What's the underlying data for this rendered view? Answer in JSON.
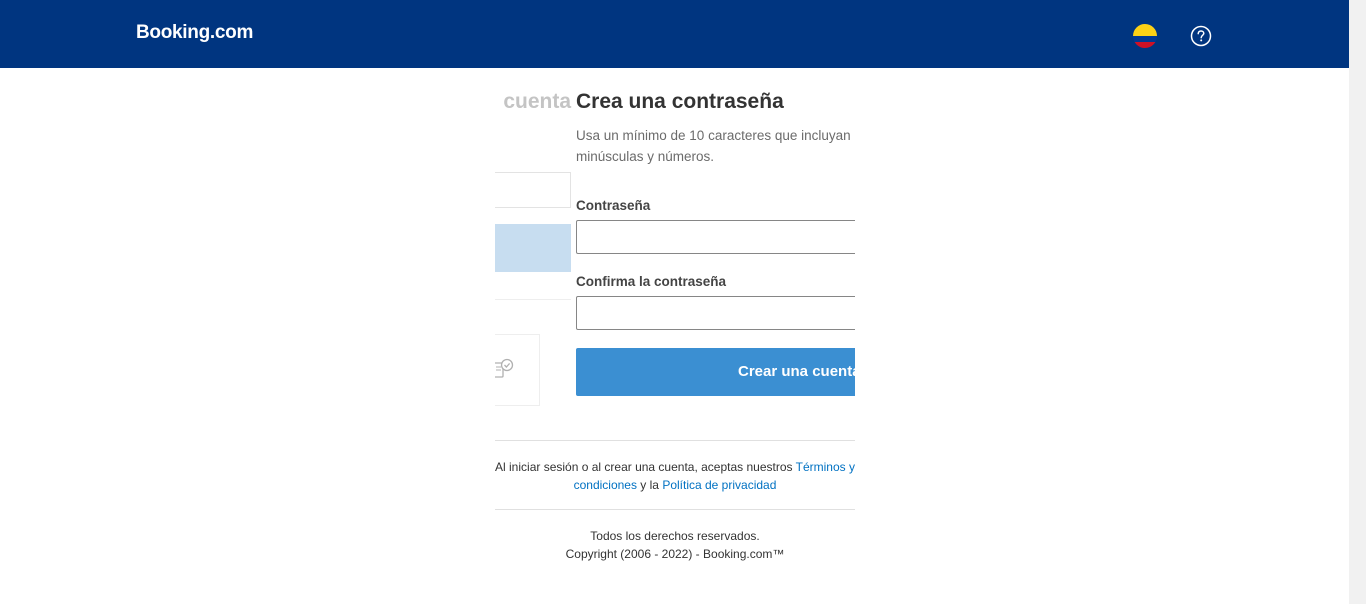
{
  "header": {
    "logo": "Booking.com",
    "flag_icon": "colombia-flag-icon",
    "help_icon": "help-circle-icon",
    "background_color": "#003580"
  },
  "previous_step": {
    "title_fragment": "cuenta"
  },
  "form": {
    "title": "Crea una contraseña",
    "subtitle": "Usa un mínimo de 10 caracteres que incluyan minúsculas y números.",
    "password_label": "Contraseña",
    "password_value": "",
    "confirm_label": "Confirma la contraseña",
    "confirm_value": "",
    "submit_label": "Crear una cuenta",
    "accent_color": "#3b8fd2"
  },
  "terms": {
    "prefix": "Al iniciar sesión o al crear una cuenta, aceptas nuestros ",
    "terms_link": "Términos y condiciones",
    "middle": " y la ",
    "privacy_link": "Política de privacidad"
  },
  "footer": {
    "rights": "Todos los derechos reservados.",
    "copyright": "Copyright (2006 - 2022) - Booking.com™"
  }
}
